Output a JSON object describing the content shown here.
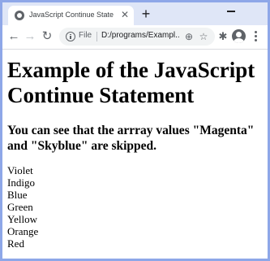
{
  "browser": {
    "tab_title": "JavaScript Continue Statement",
    "close_glyph": "✕",
    "new_tab_glyph": "+",
    "scheme_label": "File",
    "url": "D:/programs/Exampl...",
    "nav": {
      "back": "←",
      "forward": "→",
      "reload": "↻"
    },
    "icons": {
      "zoom": "⊕",
      "star": "☆",
      "extensions": "✱"
    }
  },
  "page": {
    "heading": "Example of the JavaScript Continue Statement",
    "subheading": "You can see that the arrray values \"Magenta\" and \"Skyblue\" are skipped.",
    "colors": [
      "Violet",
      "Indigo",
      "Blue",
      "Green",
      "Yellow",
      "Orange",
      "Red"
    ]
  },
  "theme": {
    "frame": "#8ea7e8",
    "tabstrip": "#dfe6f7",
    "icon": "#5f6368"
  }
}
